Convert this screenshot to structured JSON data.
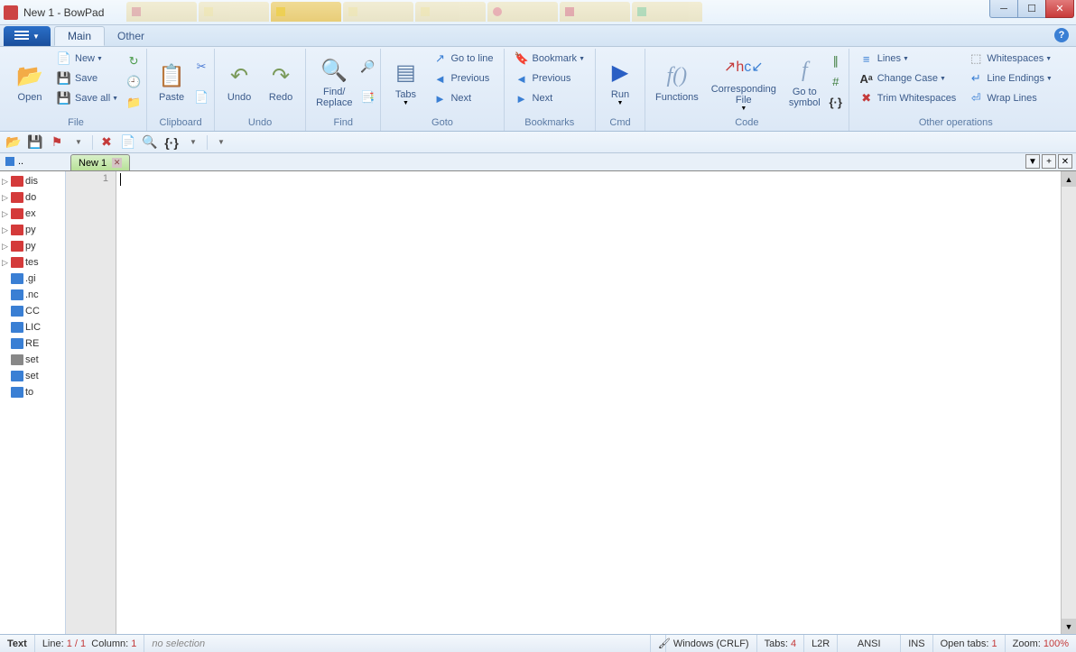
{
  "window": {
    "title": "New 1 - BowPad"
  },
  "ribbon_tabs": {
    "main": "Main",
    "other": "Other"
  },
  "file_group": {
    "label": "File",
    "open": "Open",
    "new": "New",
    "save": "Save",
    "save_all": "Save all"
  },
  "clipboard": {
    "label": "Clipboard",
    "paste": "Paste"
  },
  "undo_group": {
    "label": "Undo",
    "undo": "Undo",
    "redo": "Redo"
  },
  "find_group": {
    "label": "Find",
    "find_replace": "Find/\nReplace"
  },
  "goto_group": {
    "label": "Goto",
    "tabs": "Tabs",
    "goto_line": "Go to line",
    "previous": "Previous",
    "next": "Next"
  },
  "bookmarks": {
    "label": "Bookmarks",
    "bookmark": "Bookmark",
    "previous": "Previous",
    "next": "Next"
  },
  "cmd": {
    "label": "Cmd",
    "run": "Run"
  },
  "code": {
    "label": "Code",
    "functions": "Functions",
    "corresponding": "Corresponding\nFile",
    "goto_symbol": "Go to\nsymbol"
  },
  "other_ops": {
    "label": "Other operations",
    "lines": "Lines",
    "change_case": "Change Case",
    "trim_ws": "Trim Whitespaces",
    "whitespaces": "Whitespaces",
    "line_endings": "Line Endings",
    "wrap_lines": "Wrap Lines"
  },
  "doc_tab": {
    "name": "New 1"
  },
  "tree": {
    "root": "..",
    "items": [
      {
        "type": "folder",
        "name": "dis"
      },
      {
        "type": "folder",
        "name": "do"
      },
      {
        "type": "folder",
        "name": "ex"
      },
      {
        "type": "folder",
        "name": "py"
      },
      {
        "type": "folder",
        "name": "py"
      },
      {
        "type": "folder",
        "name": "tes"
      },
      {
        "type": "file",
        "name": ".gi"
      },
      {
        "type": "file",
        "name": ".nc"
      },
      {
        "type": "file",
        "name": "CC"
      },
      {
        "type": "file",
        "name": "LIC"
      },
      {
        "type": "file",
        "name": "RE"
      },
      {
        "type": "bin",
        "name": "set"
      },
      {
        "type": "file",
        "name": "set"
      },
      {
        "type": "file",
        "name": "to"
      }
    ]
  },
  "gutter": {
    "line1": "1"
  },
  "status": {
    "lang": "Text",
    "line_label": "Line:",
    "line_val": "1 / 1",
    "col_label": "Column:",
    "col_val": "1",
    "selection": "no selection",
    "eol": "Windows (CRLF)",
    "tabs_label": "Tabs:",
    "tabs_val": "4",
    "dir": "L2R",
    "enc": "ANSI",
    "ins": "INS",
    "open_tabs_label": "Open tabs:",
    "open_tabs_val": "1",
    "zoom_label": "Zoom:",
    "zoom_val": "100%"
  }
}
